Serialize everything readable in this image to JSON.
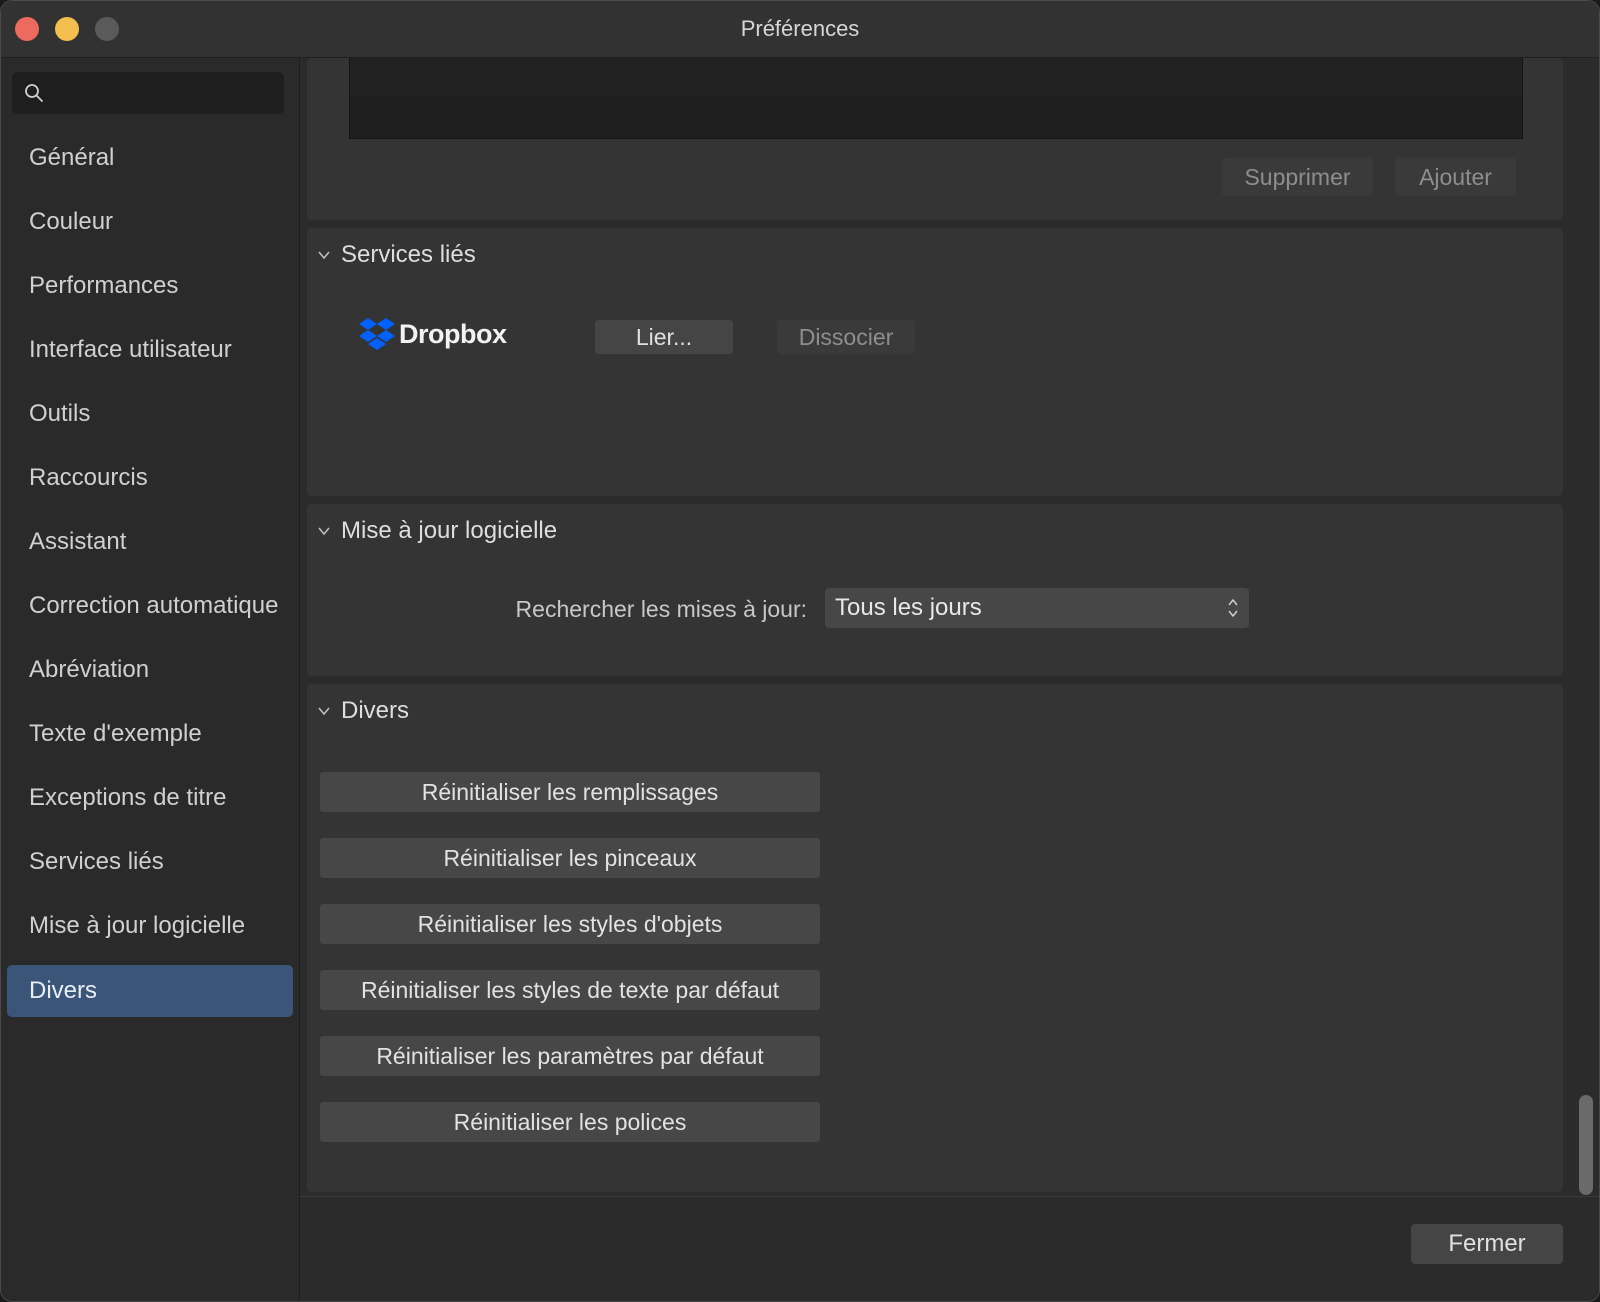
{
  "window": {
    "title": "Préférences"
  },
  "sidebar": {
    "search_placeholder": "",
    "items": [
      {
        "label": "Général"
      },
      {
        "label": "Couleur"
      },
      {
        "label": "Performances"
      },
      {
        "label": "Interface utilisateur"
      },
      {
        "label": "Outils"
      },
      {
        "label": "Raccourcis"
      },
      {
        "label": "Assistant"
      },
      {
        "label": "Correction automatique"
      },
      {
        "label": "Abréviation"
      },
      {
        "label": "Texte d'exemple"
      },
      {
        "label": "Exceptions de titre"
      },
      {
        "label": "Services liés"
      },
      {
        "label": "Mise à jour logicielle"
      },
      {
        "label": "Divers"
      }
    ],
    "active_index": 13
  },
  "top_panel": {
    "delete_label": "Supprimer",
    "add_label": "Ajouter"
  },
  "linked_services": {
    "title": "Services liés",
    "dropbox_label": "Dropbox",
    "link_label": "Lier...",
    "unlink_label": "Dissocier"
  },
  "software_update": {
    "title": "Mise à jour logicielle",
    "check_label": "Rechercher les mises à jour:",
    "frequency_value": "Tous les jours"
  },
  "misc": {
    "title": "Divers",
    "buttons": [
      {
        "label": "Réinitialiser les remplissages"
      },
      {
        "label": "Réinitialiser les pinceaux"
      },
      {
        "label": "Réinitialiser les styles d'objets"
      },
      {
        "label": "Réinitialiser les styles de texte par défaut"
      },
      {
        "label": "Réinitialiser les paramètres par défaut"
      },
      {
        "label": "Réinitialiser les polices"
      }
    ]
  },
  "footer": {
    "close_label": "Fermer"
  },
  "colors": {
    "accent": "#3a5578",
    "dropbox_blue": "#0061fe"
  }
}
